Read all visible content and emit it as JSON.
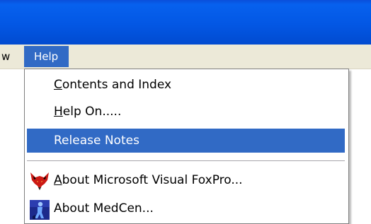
{
  "menubar": {
    "prev_label": "w",
    "help_label": "Help"
  },
  "help_menu": {
    "items": [
      {
        "label_accel": "C",
        "label_rest": "ontents and Index"
      },
      {
        "label_accel": "H",
        "label_rest": "elp On....."
      },
      {
        "label": "Release Notes",
        "selected": true
      },
      {
        "label_accel": "A",
        "label_rest": "bout Microsoft Visual FoxPro...",
        "icon": "foxpro-fox-icon"
      },
      {
        "label": "About MedCen...",
        "icon": "medcen-icon"
      }
    ]
  },
  "colors": {
    "titlebar": "#0357e4",
    "menubar": "#ece9d8",
    "selection": "#316ac5"
  }
}
